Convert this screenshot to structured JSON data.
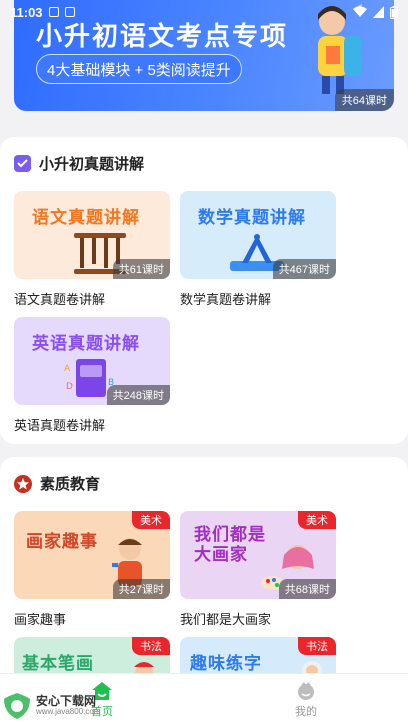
{
  "status_bar": {
    "time": "11:03"
  },
  "hero": {
    "title": "小升初语文考点专项",
    "subtitle": "4大基础模块 + 5类阅读提升",
    "lesson_count": "共64课时"
  },
  "section_exam": {
    "title": "小升初真题讲解",
    "items": [
      {
        "thumb_title": "语文真题讲解",
        "lessons": "共61课时",
        "caption": "语文真题卷讲解"
      },
      {
        "thumb_title": "数学真题讲解",
        "lessons": "共467课时",
        "caption": "数学真题卷讲解"
      },
      {
        "thumb_title": "英语真题讲解",
        "lessons": "共248课时",
        "caption": "英语真题卷讲解"
      }
    ]
  },
  "section_quality": {
    "title": "素质教育",
    "items": [
      {
        "thumb_title": "画家趣事",
        "tag": "美术",
        "lessons": "共27课时",
        "caption": "画家趣事"
      },
      {
        "thumb_title": "我们都是大画家",
        "tag": "美术",
        "lessons": "共68课时",
        "caption": "我们都是大画家"
      },
      {
        "thumb_title": "基本笔画",
        "tag": "书法"
      },
      {
        "thumb_title": "趣味练字",
        "tag": "书法"
      }
    ]
  },
  "bottom_nav": {
    "home_label": "首页",
    "mine_label": "我的"
  },
  "watermark": {
    "title": "安心下载网",
    "url": "www.java800.com"
  },
  "colors": {
    "accent_green": "#1fbf52",
    "tag_red": "#e8262b",
    "hero_blue": "#2f6cff"
  }
}
